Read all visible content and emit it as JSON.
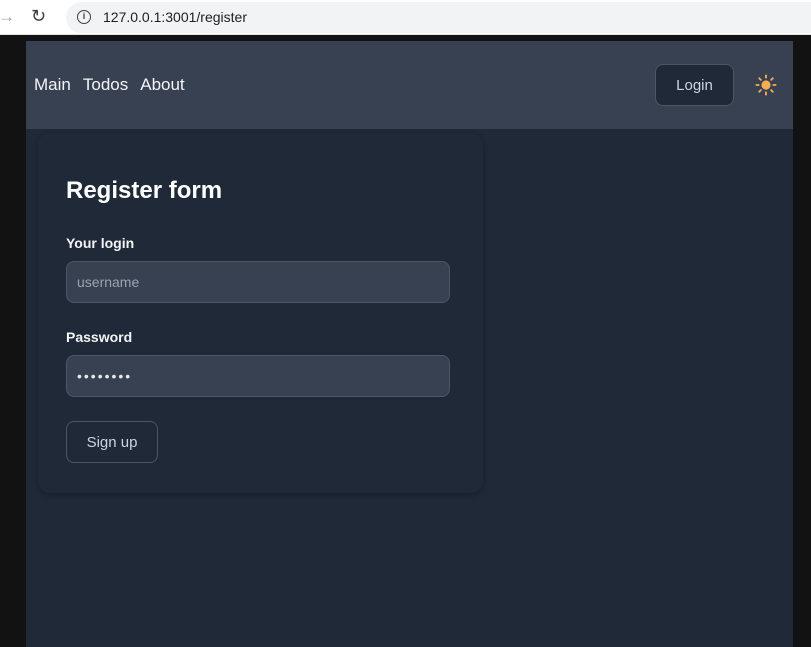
{
  "browser": {
    "url": "127.0.0.1:3001/register",
    "forward_icon": "arrow-right-icon",
    "reload_icon": "reload-icon",
    "info_icon": "info-icon"
  },
  "header": {
    "nav": [
      "Main",
      "Todos",
      "About"
    ],
    "login_label": "Login",
    "theme_icon": "sun-icon"
  },
  "form": {
    "title": "Register form",
    "login_label": "Your login",
    "login_placeholder": "username",
    "login_value": "",
    "password_label": "Password",
    "password_value": "password",
    "submit_label": "Sign up"
  },
  "colors": {
    "header_bg": "#374151",
    "page_bg": "#1f2937",
    "accent_sun": "#f6ad55"
  }
}
